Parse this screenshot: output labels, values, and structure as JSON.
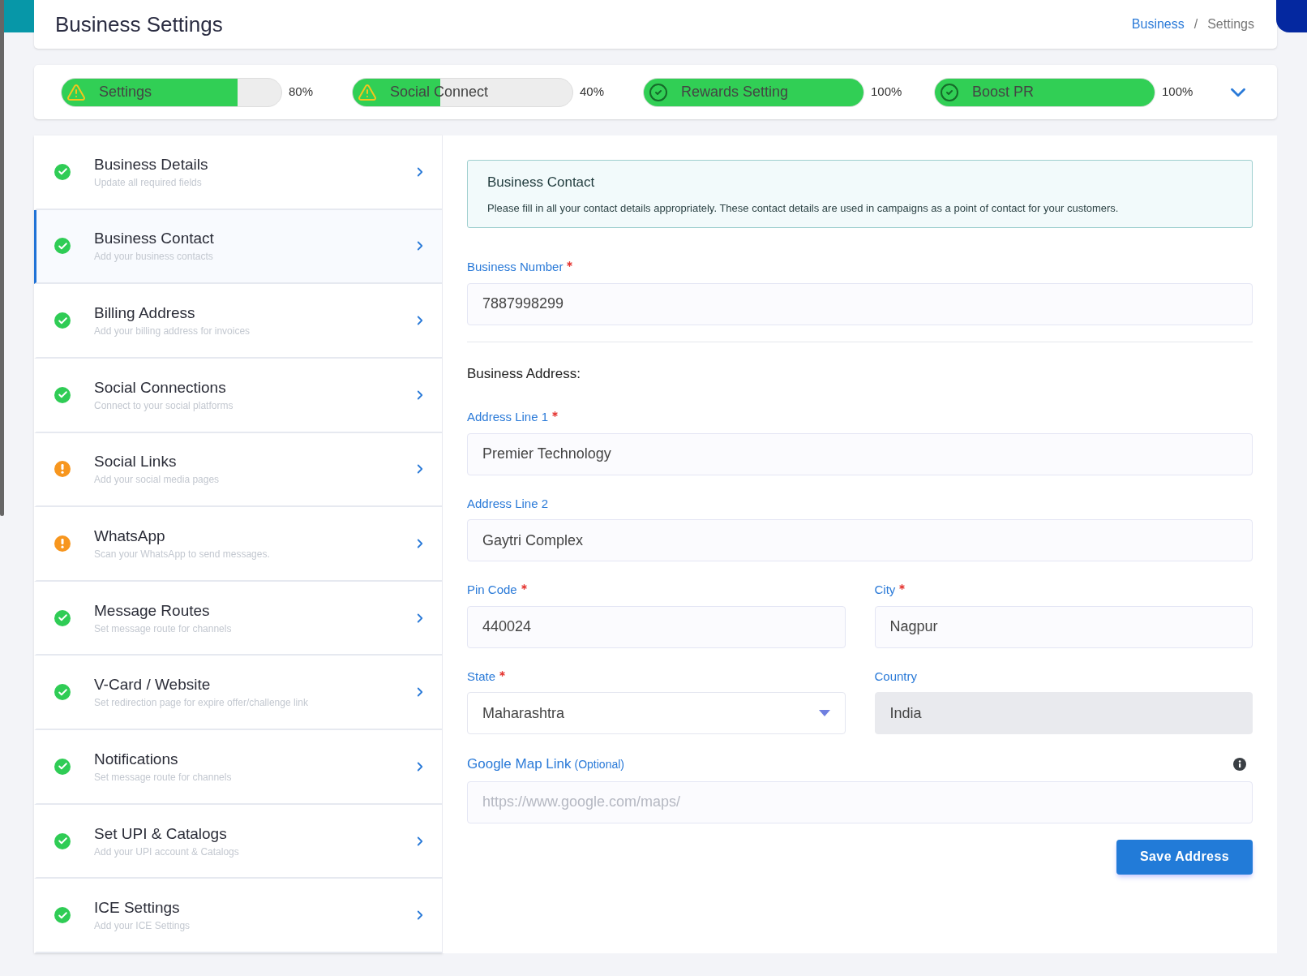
{
  "header": {
    "title": "Business Settings",
    "breadcrumb": [
      {
        "label": "Business",
        "kind": "link"
      },
      {
        "label": "Settings",
        "kind": "current"
      }
    ],
    "separator": "/"
  },
  "progress": [
    {
      "label": "Settings",
      "kind": "warning",
      "level": 0.8,
      "reading": "80%"
    },
    {
      "label": "Social Connect",
      "kind": "warning",
      "level": 0.4,
      "reading": "40%"
    },
    {
      "label": "Rewards Setting",
      "kind": "complete",
      "level": 1,
      "reading": "100%"
    },
    {
      "label": "Boost PR",
      "kind": "complete",
      "level": 1,
      "reading": "100%"
    }
  ],
  "sidebar": {
    "items": [
      {
        "title": "Business Details",
        "subtitle": "Update all required fields",
        "kind": "complete",
        "selected": false
      },
      {
        "title": "Business Contact",
        "subtitle": "Add your business contacts",
        "kind": "complete",
        "selected": true
      },
      {
        "title": "Billing Address",
        "subtitle": "Add your billing address for invoices",
        "kind": "complete",
        "selected": false
      },
      {
        "title": "Social Connections",
        "subtitle": "Connect to your social platforms",
        "kind": "complete",
        "selected": false
      },
      {
        "title": "Social Links",
        "subtitle": "Add your social media pages",
        "kind": "warning",
        "selected": false
      },
      {
        "title": "WhatsApp",
        "subtitle": "Scan your WhatsApp to send messages.",
        "kind": "warning",
        "selected": false
      },
      {
        "title": "Message Routes",
        "subtitle": "Set message route for channels",
        "kind": "complete",
        "selected": false
      },
      {
        "title": "V-Card / Website",
        "subtitle": "Set redirection page for expire offer/challenge link",
        "kind": "complete",
        "selected": false
      },
      {
        "title": "Notifications",
        "subtitle": "Set message route for channels",
        "kind": "complete",
        "selected": false
      },
      {
        "title": "Set UPI & Catalogs",
        "subtitle": "Add your UPI account & Catalogs",
        "kind": "complete",
        "selected": false
      },
      {
        "title": "ICE Settings",
        "subtitle": "Add your ICE Settings",
        "kind": "complete",
        "selected": false
      }
    ]
  },
  "info": {
    "title": "Business Contact",
    "text": "Please fill in all your contact details appropriately. These contact details are used in campaigns as a point of contact for your customers."
  },
  "business_number": {
    "label": "Business Number",
    "required": true,
    "value": "7887998299"
  },
  "address_heading": "Business Address:",
  "address_rows": [
    [
      {
        "label": "Address Line 1",
        "required": true,
        "kind": "text",
        "value": "Premier Technology"
      }
    ],
    [
      {
        "label": "Address Line 2",
        "required": false,
        "kind": "text",
        "value": "Gaytri Complex"
      }
    ],
    [
      {
        "label": "Pin Code",
        "required": true,
        "kind": "text",
        "value": "440024"
      },
      {
        "label": "City",
        "required": true,
        "kind": "text",
        "value": "Nagpur"
      }
    ],
    [
      {
        "label": "State",
        "required": true,
        "kind": "select",
        "value": "Maharashtra"
      },
      {
        "label": "Country",
        "required": false,
        "kind": "readonly",
        "value": "India"
      }
    ]
  ],
  "map_link": {
    "label": "Google Map Link",
    "note": "(Optional)",
    "placeholder": "https://www.google.com/maps/"
  },
  "save_button": "Save Address"
}
